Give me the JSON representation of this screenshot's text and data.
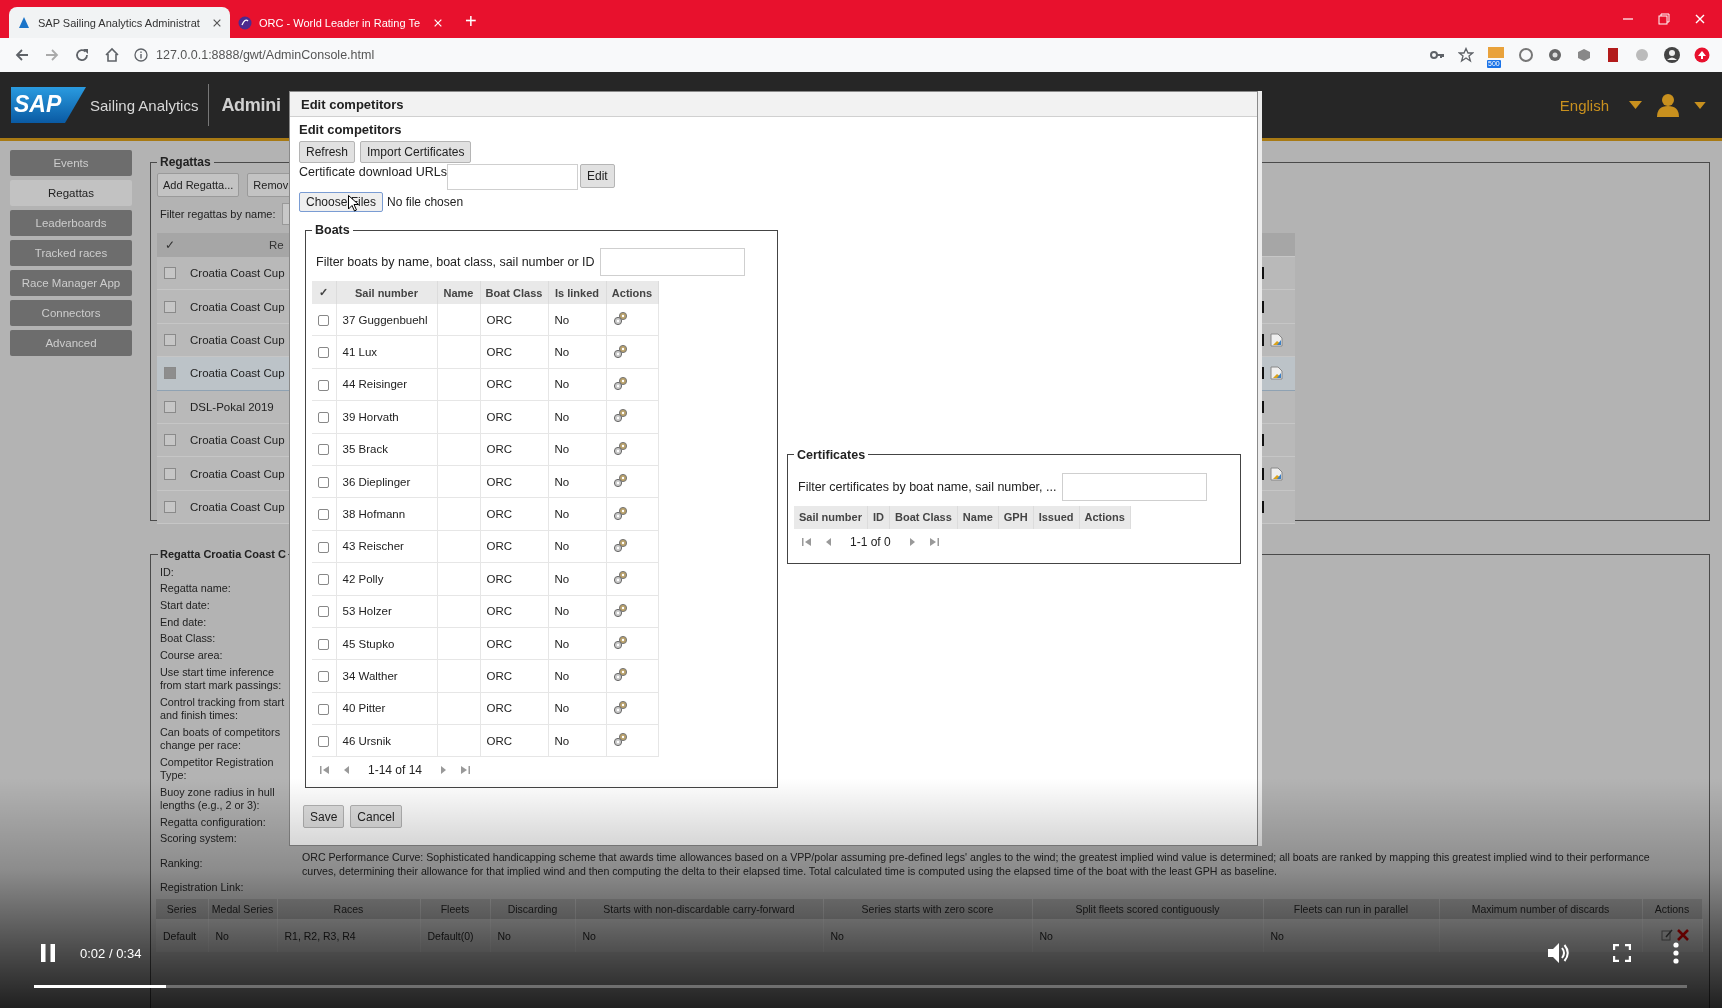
{
  "browser": {
    "tabs": [
      {
        "title": "SAP Sailing Analytics Administrat",
        "selected": true
      },
      {
        "title": "ORC - World Leader in Rating Te",
        "selected": false
      }
    ],
    "new_tab": "+",
    "address": "127.0.0.1:8888/gwt/AdminConsole.html",
    "badge": "500"
  },
  "header": {
    "logo": "SAP",
    "product": "Sailing Analytics",
    "title": "Admini",
    "language": "English"
  },
  "sidebar": {
    "items": [
      {
        "label": "Events",
        "selected": false
      },
      {
        "label": "Regattas",
        "selected": true
      },
      {
        "label": "Leaderboards",
        "selected": false
      },
      {
        "label": "Tracked races",
        "selected": false
      },
      {
        "label": "Race Manager App",
        "selected": false
      },
      {
        "label": "Connectors",
        "selected": false
      },
      {
        "label": "Advanced",
        "selected": false
      }
    ]
  },
  "regattas": {
    "legend": "Regattas",
    "buttons": [
      "Add Regatta...",
      "Remov"
    ],
    "filter_label": "Filter regattas by name:",
    "columns": [
      "✓",
      "Re"
    ],
    "rows": [
      {
        "name": "Croatia Coast Cup",
        "selected": false,
        "chart_icon": false
      },
      {
        "name": "Croatia Coast Cup",
        "selected": false,
        "chart_icon": false
      },
      {
        "name": "Croatia Coast Cup",
        "selected": false,
        "chart_icon": true
      },
      {
        "name": "Croatia Coast Cup",
        "selected": true,
        "chart_icon": true
      },
      {
        "name": "DSL-Pokal 2019",
        "selected": false,
        "chart_icon": false
      },
      {
        "name": "Croatia Coast Cup",
        "selected": false,
        "chart_icon": false
      },
      {
        "name": "Croatia Coast Cup",
        "selected": false,
        "chart_icon": true
      },
      {
        "name": "Croatia Coast Cup",
        "selected": false,
        "chart_icon": false
      }
    ]
  },
  "details": {
    "legend": "Regatta Croatia Coast C",
    "fields": [
      {
        "label": "ID:"
      },
      {
        "label": "Regatta name:"
      },
      {
        "label": "Start date:"
      },
      {
        "label": "End date:"
      },
      {
        "label": "Boat Class:"
      },
      {
        "label": "Course area:"
      },
      {
        "label": "Use start time inference from start mark passings:"
      },
      {
        "label": "Control tracking from start and finish times:"
      },
      {
        "label": "Can boats of competitors change per race:"
      },
      {
        "label": "Competitor Registration Type:"
      },
      {
        "label": "Buoy zone radius in hull lengths (e.g., 2 or 3):"
      },
      {
        "label": "Regatta configuration:"
      },
      {
        "label": "Scoring system:"
      },
      {
        "label": "Ranking:",
        "value": "ORC Performance Curve: Sophisticated handicapping scheme that awards time allowances based on a VPP/polar assuming pre-defined legs' angles to the wind; the greatest implied wind value is determined; all boats are ranked by mapping this greatest implied wind to their performance curves, determining their allowance for that implied wind and then computing the delta to their elapsed time. Total calculated time is computed using the elapsed time of the boat with the least GPH as baseline."
      },
      {
        "label": "Registration Link:"
      }
    ],
    "series_table": {
      "columns": [
        "Series",
        "Medal Series",
        "Races",
        "Fleets",
        "Discarding",
        "Starts with non-discardable carry-forward",
        "Series starts with zero score",
        "Split fleets scored contiguously",
        "Fleets can run in parallel",
        "Maximum number of discards",
        "Actions"
      ],
      "rows": [
        {
          "cells": [
            "Default",
            "No",
            "R1, R2, R3, R4",
            "Default(0)",
            "No",
            "No",
            "No",
            "No",
            "No"
          ]
        }
      ]
    }
  },
  "dialog": {
    "title": "Edit competitors",
    "heading": "Edit competitors",
    "buttons": [
      "Refresh",
      "Import Certificates"
    ],
    "url_label": "Certificate download URLs",
    "edit_button": "Edit",
    "file_button": "Choose Files",
    "file_status": "No file chosen",
    "boats": {
      "legend": "Boats",
      "filter_label": "Filter boats by name, boat class, sail number or ID",
      "columns": [
        "✓",
        "Sail number",
        "Name",
        "Boat Class",
        "Is linked",
        "Actions"
      ],
      "rows": [
        {
          "sail_number": "37 Guggenbuehl",
          "boat_class": "ORC",
          "linked": "No",
          "checked": false
        },
        {
          "sail_number": "41 Lux",
          "boat_class": "ORC",
          "linked": "No",
          "checked": false
        },
        {
          "sail_number": "44 Reisinger",
          "boat_class": "ORC",
          "linked": "No",
          "checked": false
        },
        {
          "sail_number": "39 Horvath",
          "boat_class": "ORC",
          "linked": "No",
          "checked": false
        },
        {
          "sail_number": "35 Brack",
          "boat_class": "ORC",
          "linked": "No",
          "checked": false
        },
        {
          "sail_number": "36 Dieplinger",
          "boat_class": "ORC",
          "linked": "No",
          "checked": false
        },
        {
          "sail_number": "38 Hofmann",
          "boat_class": "ORC",
          "linked": "No",
          "checked": false
        },
        {
          "sail_number": "43 Reischer",
          "boat_class": "ORC",
          "linked": "No",
          "checked": false
        },
        {
          "sail_number": "42 Polly",
          "boat_class": "ORC",
          "linked": "No",
          "checked": false
        },
        {
          "sail_number": "53 Holzer",
          "boat_class": "ORC",
          "linked": "No",
          "checked": false
        },
        {
          "sail_number": "45 Stupko",
          "boat_class": "ORC",
          "linked": "No",
          "checked": false
        },
        {
          "sail_number": "34 Walther",
          "boat_class": "ORC",
          "linked": "No",
          "checked": false
        },
        {
          "sail_number": "40 Pitter",
          "boat_class": "ORC",
          "linked": "No",
          "checked": false
        },
        {
          "sail_number": "46 Ursnik",
          "boat_class": "ORC",
          "linked": "No",
          "checked": false
        }
      ],
      "pager": "1-14 of 14"
    },
    "certificates": {
      "legend": "Certificates",
      "filter_label": "Filter certificates by boat name, sail number, ...",
      "columns": [
        "Sail number",
        "ID",
        "Boat Class",
        "Name",
        "GPH",
        "Issued",
        "Actions"
      ],
      "pager": "1-1 of 0"
    },
    "footer_buttons": [
      "Save",
      "Cancel"
    ]
  },
  "video": {
    "playing": true,
    "time": "0:02 / 0:34",
    "level": 0.08
  }
}
